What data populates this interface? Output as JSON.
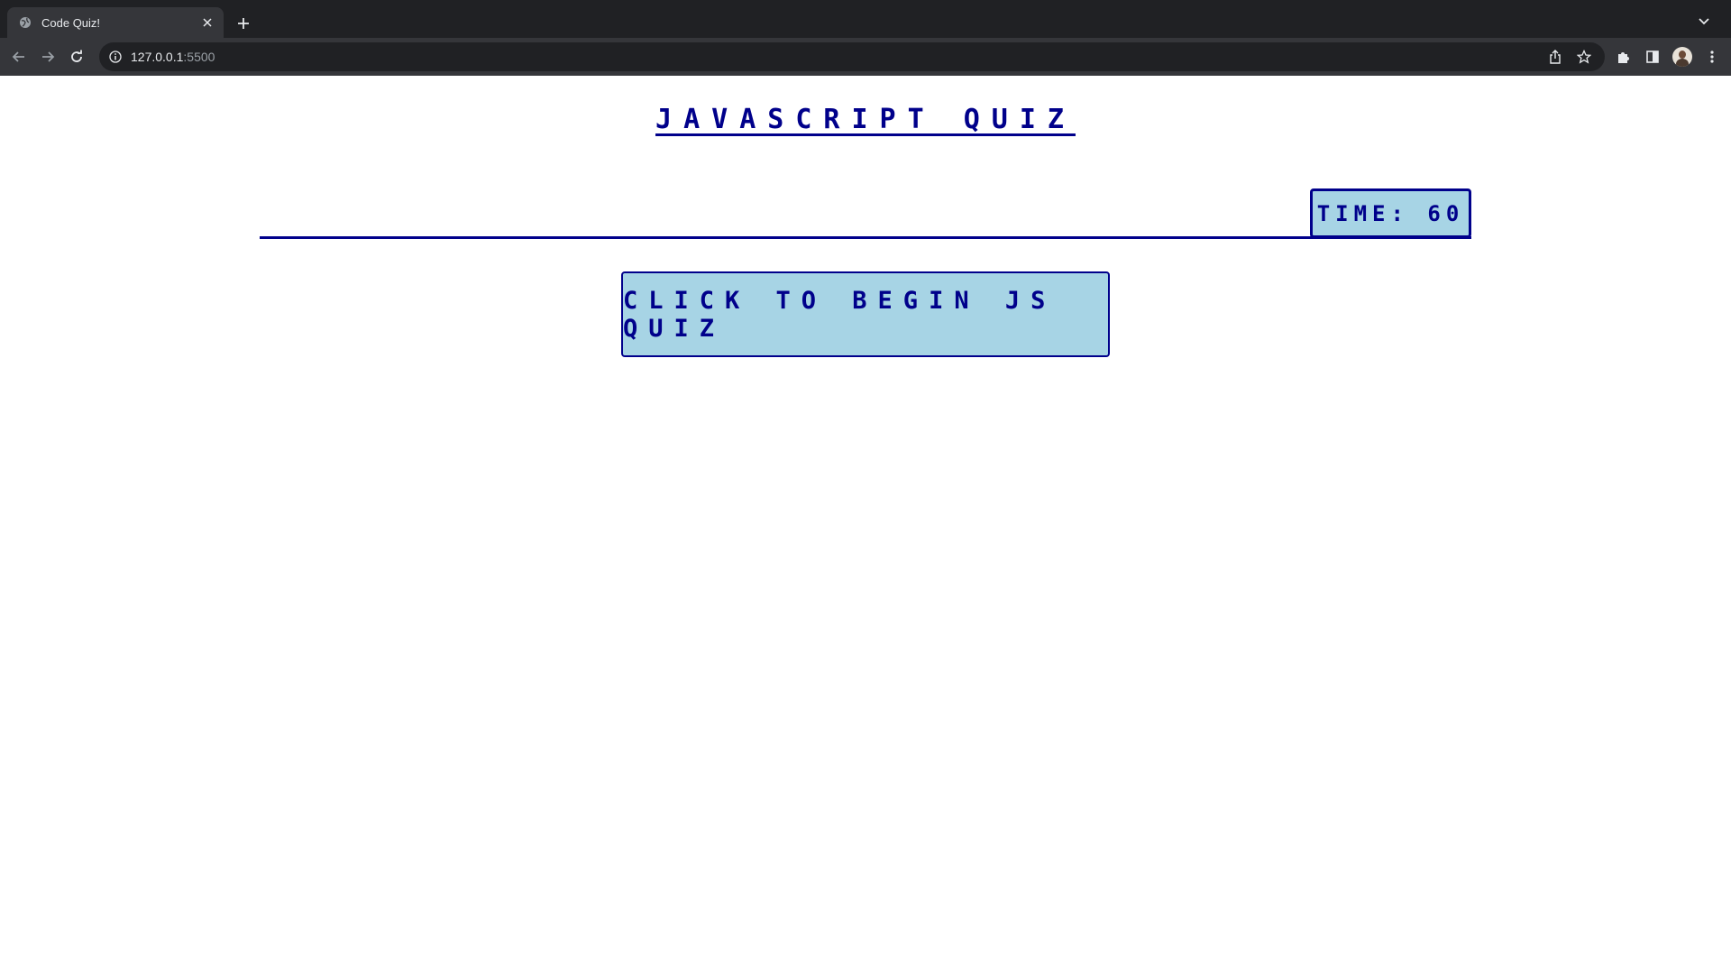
{
  "browser": {
    "tab_title": "Code Quiz!",
    "url_host": "127.0.0.1",
    "url_port": ":5500"
  },
  "page": {
    "title": "JAVASCRIPT QUIZ",
    "timer_label": "TIME:",
    "timer_value": "60",
    "start_button_label": "CLICK TO BEGIN JS QUIZ"
  },
  "colors": {
    "accent": "#00008b",
    "panel": "#a7d4e5",
    "chrome_dark": "#202124",
    "chrome_toolbar": "#35363a"
  },
  "icons": {
    "tab_favicon": "globe-icon",
    "tab_close": "close-icon",
    "new_tab": "plus-icon",
    "back": "back-arrow-icon",
    "forward": "forward-arrow-icon",
    "reload": "reload-icon",
    "site_info": "info-icon",
    "share": "share-icon",
    "bookmark": "star-icon",
    "extensions": "puzzle-icon",
    "side_panel": "side-panel-icon",
    "menu": "kebab-menu-icon",
    "tab_search": "chevron-down-icon"
  }
}
